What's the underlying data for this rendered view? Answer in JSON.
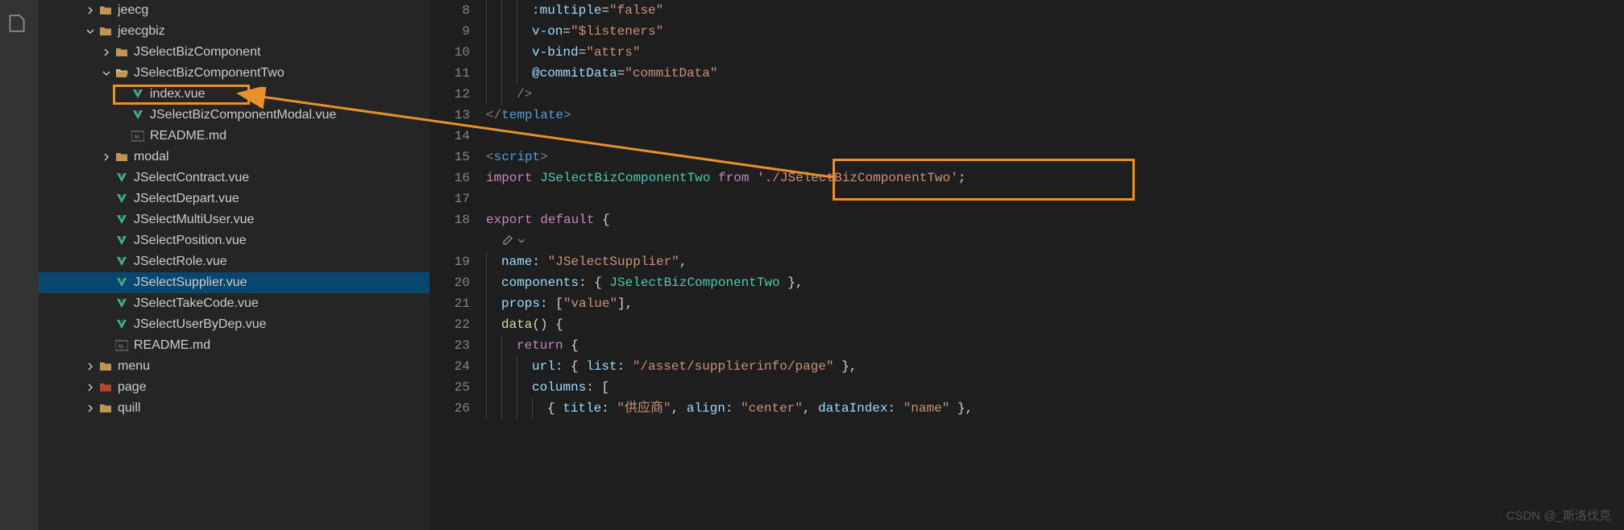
{
  "watermark": "CSDN @_斯洛伐克",
  "sidebar": {
    "items": [
      {
        "indent": 56,
        "chev": "right",
        "icon": "folder",
        "label": "jeecg"
      },
      {
        "indent": 56,
        "chev": "down",
        "icon": "folder",
        "label": "jeecgbiz"
      },
      {
        "indent": 76,
        "chev": "right",
        "icon": "folder",
        "label": "JSelectBizComponent"
      },
      {
        "indent": 76,
        "chev": "down",
        "icon": "folder-open",
        "label": "JSelectBizComponentTwo"
      },
      {
        "indent": 96,
        "chev": "",
        "icon": "vue",
        "label": "index.vue",
        "boxed": true
      },
      {
        "indent": 96,
        "chev": "",
        "icon": "vue",
        "label": "JSelectBizComponentModal.vue"
      },
      {
        "indent": 96,
        "chev": "",
        "icon": "md",
        "label": "README.md"
      },
      {
        "indent": 76,
        "chev": "right",
        "icon": "folder",
        "label": "modal"
      },
      {
        "indent": 76,
        "chev": "",
        "icon": "vue",
        "label": "JSelectContract.vue"
      },
      {
        "indent": 76,
        "chev": "",
        "icon": "vue",
        "label": "JSelectDepart.vue"
      },
      {
        "indent": 76,
        "chev": "",
        "icon": "vue",
        "label": "JSelectMultiUser.vue"
      },
      {
        "indent": 76,
        "chev": "",
        "icon": "vue",
        "label": "JSelectPosition.vue"
      },
      {
        "indent": 76,
        "chev": "",
        "icon": "vue",
        "label": "JSelectRole.vue"
      },
      {
        "indent": 76,
        "chev": "",
        "icon": "vue",
        "label": "JSelectSupplier.vue",
        "selected": true
      },
      {
        "indent": 76,
        "chev": "",
        "icon": "vue",
        "label": "JSelectTakeCode.vue"
      },
      {
        "indent": 76,
        "chev": "",
        "icon": "vue",
        "label": "JSelectUserByDep.vue"
      },
      {
        "indent": 76,
        "chev": "",
        "icon": "md",
        "label": "README.md"
      },
      {
        "indent": 56,
        "chev": "right",
        "icon": "folder",
        "label": "menu"
      },
      {
        "indent": 56,
        "chev": "right",
        "icon": "folder-red",
        "label": "page"
      },
      {
        "indent": 56,
        "chev": "right",
        "icon": "folder",
        "label": "quill"
      }
    ]
  },
  "editor": {
    "lines": [
      {
        "n": 8,
        "seg": [
          [
            "ig",
            3
          ],
          [
            "attr",
            ":multiple"
          ],
          [
            "pl",
            "="
          ],
          [
            "str",
            "\"false\""
          ]
        ]
      },
      {
        "n": 9,
        "seg": [
          [
            "ig",
            3
          ],
          [
            "attr",
            "v-on"
          ],
          [
            "pl",
            "="
          ],
          [
            "str",
            "\"$listeners\""
          ]
        ]
      },
      {
        "n": 10,
        "seg": [
          [
            "ig",
            3
          ],
          [
            "attr",
            "v-bind"
          ],
          [
            "pl",
            "="
          ],
          [
            "str",
            "\"attrs\""
          ]
        ]
      },
      {
        "n": 11,
        "seg": [
          [
            "ig",
            3
          ],
          [
            "attr",
            "@commitData"
          ],
          [
            "pl",
            "="
          ],
          [
            "str",
            "\"commitData\""
          ]
        ]
      },
      {
        "n": 12,
        "seg": [
          [
            "ig",
            2
          ],
          [
            "tag",
            "/>"
          ]
        ]
      },
      {
        "n": 13,
        "seg": [
          [
            "tag",
            "</"
          ],
          [
            "el",
            "template"
          ],
          [
            "tag",
            ">"
          ]
        ]
      },
      {
        "n": 14,
        "seg": []
      },
      {
        "n": 15,
        "seg": [
          [
            "tag",
            "<"
          ],
          [
            "el",
            "script"
          ],
          [
            "tag",
            ">"
          ]
        ]
      },
      {
        "n": 16,
        "seg": [
          [
            "kw",
            "import"
          ],
          [
            "pl",
            " "
          ],
          [
            "id",
            "JSelectBizComponentTwo"
          ],
          [
            "pl",
            " "
          ],
          [
            "kw",
            "from"
          ],
          [
            "pl",
            " "
          ],
          [
            "str",
            "'./JSelectBizComponentTwo'"
          ],
          [
            "pl",
            ";"
          ]
        ]
      },
      {
        "n": 17,
        "seg": []
      },
      {
        "n": 18,
        "seg": [
          [
            "kw",
            "export"
          ],
          [
            "pl",
            " "
          ],
          [
            "kw",
            "default"
          ],
          [
            "pl",
            " {"
          ]
        ]
      },
      {
        "n": "",
        "seg": [
          [
            "codelens",
            ""
          ]
        ]
      },
      {
        "n": 19,
        "seg": [
          [
            "ig",
            1
          ],
          [
            "attr",
            "name"
          ],
          [
            "pl",
            ": "
          ],
          [
            "str",
            "\"JSelectSupplier\""
          ],
          [
            "pl",
            ","
          ]
        ]
      },
      {
        "n": 20,
        "seg": [
          [
            "ig",
            1
          ],
          [
            "attr",
            "components"
          ],
          [
            "pl",
            ": { "
          ],
          [
            "id",
            "JSelectBizComponentTwo"
          ],
          [
            "pl",
            " },"
          ]
        ]
      },
      {
        "n": 21,
        "seg": [
          [
            "ig",
            1
          ],
          [
            "attr",
            "props"
          ],
          [
            "pl",
            ": ["
          ],
          [
            "str",
            "\"value\""
          ],
          [
            "pl",
            "],"
          ]
        ]
      },
      {
        "n": 22,
        "seg": [
          [
            "ig",
            1
          ],
          [
            "fn",
            "data"
          ],
          [
            "pl",
            "() {"
          ]
        ]
      },
      {
        "n": 23,
        "seg": [
          [
            "ig",
            2
          ],
          [
            "kw",
            "return"
          ],
          [
            "pl",
            " {"
          ]
        ]
      },
      {
        "n": 24,
        "seg": [
          [
            "ig",
            3
          ],
          [
            "attr",
            "url"
          ],
          [
            "pl",
            ": { "
          ],
          [
            "attr",
            "list"
          ],
          [
            "pl",
            ": "
          ],
          [
            "str",
            "\"/asset/supplierinfo/page\""
          ],
          [
            "pl",
            " },"
          ]
        ]
      },
      {
        "n": 25,
        "seg": [
          [
            "ig",
            3
          ],
          [
            "attr",
            "columns"
          ],
          [
            "pl",
            ": ["
          ]
        ]
      },
      {
        "n": 26,
        "seg": [
          [
            "ig",
            4
          ],
          [
            "pl",
            "{ "
          ],
          [
            "attr",
            "title"
          ],
          [
            "pl",
            ": "
          ],
          [
            "str",
            "\"供应商\""
          ],
          [
            "pl",
            ", "
          ],
          [
            "attr",
            "align"
          ],
          [
            "pl",
            ": "
          ],
          [
            "str",
            "\"center\""
          ],
          [
            "pl",
            ", "
          ],
          [
            "attr",
            "dataIndex"
          ],
          [
            "pl",
            ": "
          ],
          [
            "str",
            "\"name\""
          ],
          [
            "pl",
            " },"
          ]
        ]
      }
    ]
  },
  "indentUnit": 19
}
